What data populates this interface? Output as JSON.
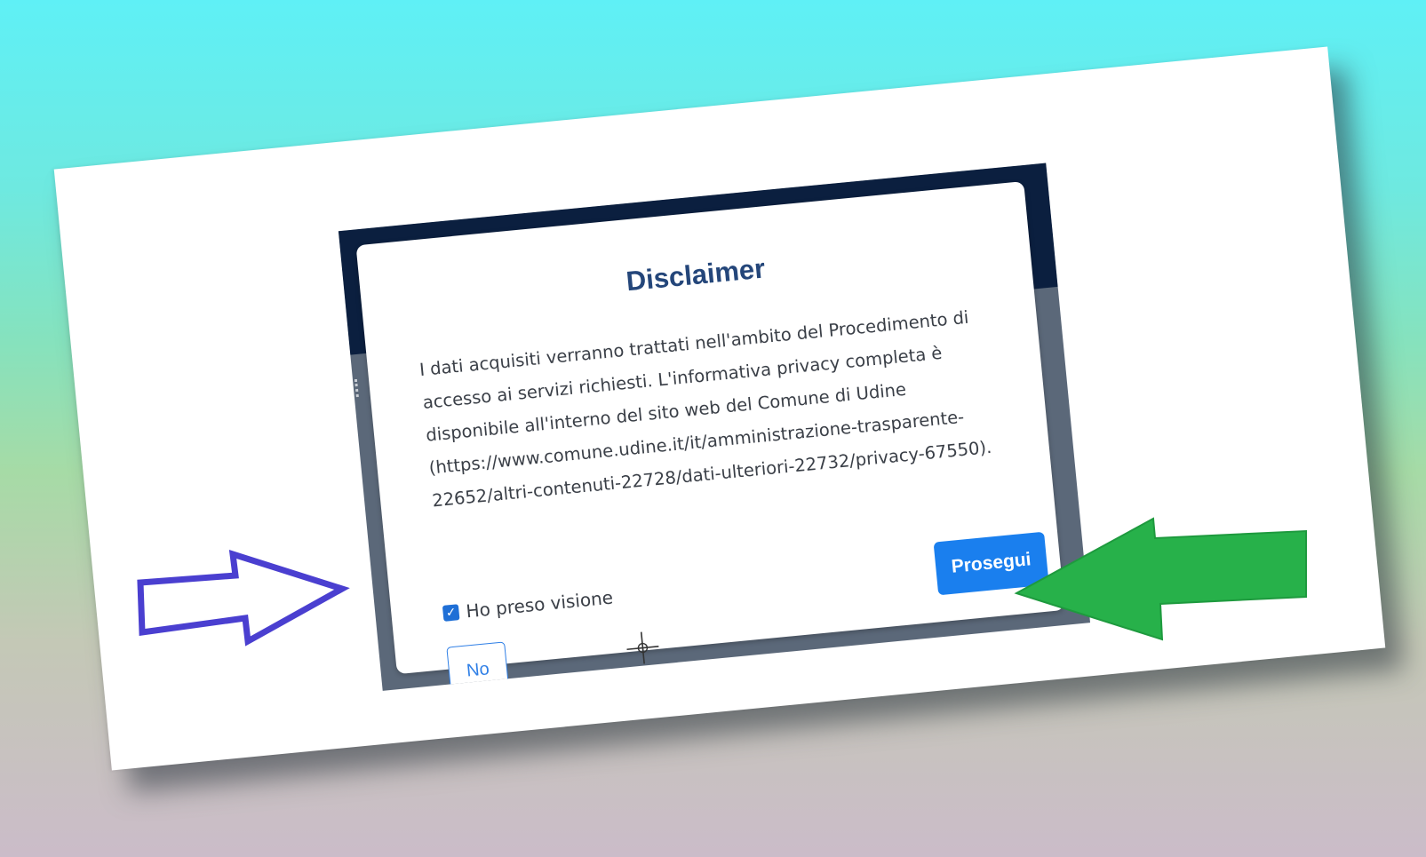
{
  "dialog": {
    "title": "Disclaimer",
    "body": "I dati acquisiti verranno trattati nell'ambito del Procedimento di accesso ai servizi richiesti. L'informativa privacy completa è disponibile all'interno del sito web del Comune di Udine (https://www.comune.udine.it/it/amministrazione-trasparente-22652/altri-contenuti-22728/dati-ulteriori-22732/privacy-67550).",
    "checkbox_label": "Ho preso visione",
    "checkbox_checked": true,
    "no_label": "No",
    "continue_label": "Prosegui"
  },
  "icons": {
    "checkbox": "checkmark-icon",
    "cursor": "crosshair-cursor-icon",
    "left_arrow": "outline-arrow-right-icon",
    "right_arrow": "solid-arrow-left-icon"
  },
  "colors": {
    "background_top": "#5ff0f6",
    "background_bottom": "#cbbcc9",
    "header_navy": "#0b1f3f",
    "title_blue": "#24467a",
    "primary_button": "#1a7fee",
    "outline_arrow": "#4a3fd0",
    "solid_arrow": "#27b14a"
  }
}
